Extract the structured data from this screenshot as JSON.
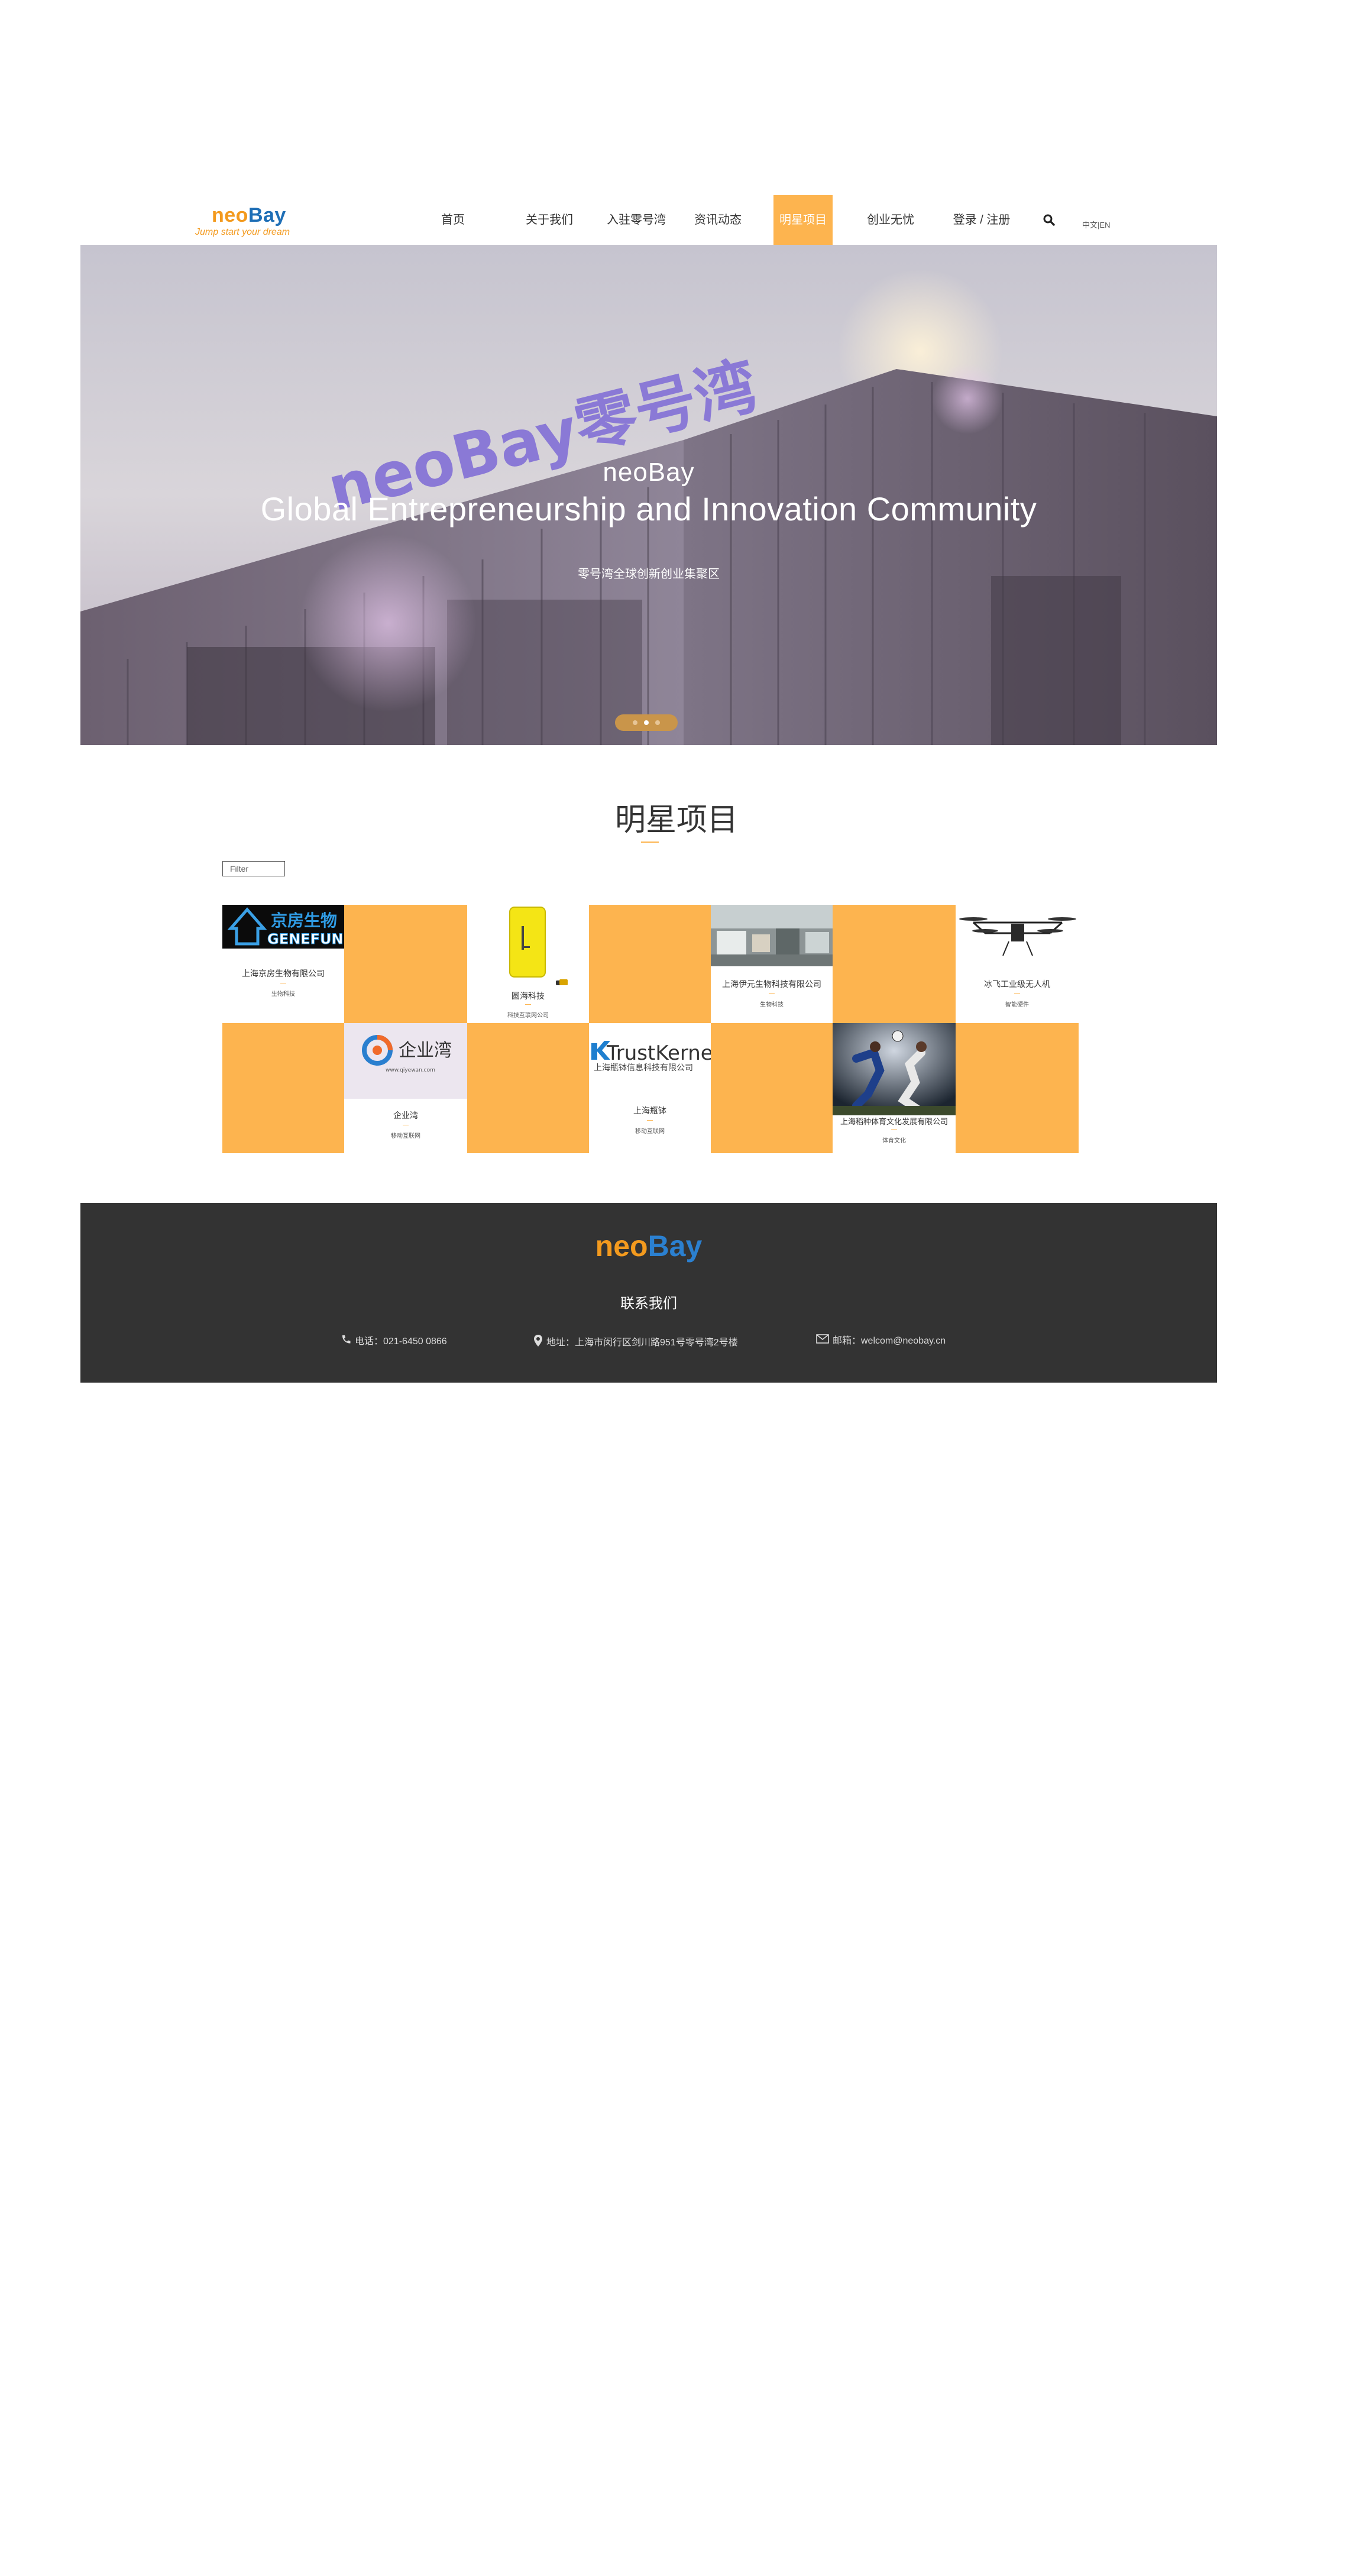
{
  "header": {
    "logo_neo": "neo",
    "logo_bay": "Bay",
    "logo_tagline": "Jump start your dream",
    "nav": [
      {
        "label": "首页",
        "active": false
      },
      {
        "label": "关于我们",
        "active": false
      },
      {
        "label": "入驻零号湾",
        "active": false
      },
      {
        "label": "资讯动态",
        "active": false
      },
      {
        "label": "明星项目",
        "active": true
      },
      {
        "label": "创业无忧",
        "active": false
      },
      {
        "label": "登录 / 注册",
        "active": false
      }
    ],
    "search_icon": "search-icon",
    "lang_zh": "中文",
    "lang_sep": "|",
    "lang_en": "EN"
  },
  "banner": {
    "building_sign": "neoBay零号湾",
    "brand": "neoBay",
    "title": "Global Entrepreneurship and Innovation Community",
    "subtitle": "零号湾全球创新创业集聚区",
    "slides": 3,
    "current_slide": 2
  },
  "projects": {
    "section_title": "明星项目",
    "filter_placeholder": "Filter",
    "items": [
      {
        "logo": "京房生物",
        "logo_en": "GENEFUND",
        "name": "上海京房生物有限公司",
        "tag": "生物科技"
      },
      {
        "logo": "",
        "logo_en": "",
        "name": "圆海科技",
        "tag": "科技互联网公司"
      },
      {
        "logo": "",
        "logo_en": "",
        "name": "上海伊元生物科技有限公司",
        "tag": "生物科技"
      },
      {
        "logo": "",
        "logo_en": "",
        "name": "冰飞工业级无人机",
        "tag": "智能硬件"
      },
      {
        "logo": "企业湾",
        "logo_en": "www.qiyewan.com",
        "name": "企业湾",
        "tag": "移动互联网"
      },
      {
        "logo": "TrustKernel",
        "logo_en": "上海瓶钵信息科技有限公司",
        "name": "上海瓶钵",
        "tag": "移动互联网"
      },
      {
        "logo": "",
        "logo_en": "",
        "name": "上海稻种体育文化发展有限公司",
        "tag": "体育文化"
      }
    ]
  },
  "footer": {
    "logo_neo": "neo",
    "logo_bay": "Bay",
    "contact_title": "联系我们",
    "phone": "电话：021-6450 0866",
    "address": "地址：上海市闵行区剑川路951号零号湾2号楼",
    "email": "邮箱：welcom@neobay.cn"
  },
  "colors": {
    "accent": "#fdb44f",
    "footer_bg": "#333333",
    "logo_orange": "#f39a1e",
    "logo_blue": "#1f6fb6"
  }
}
